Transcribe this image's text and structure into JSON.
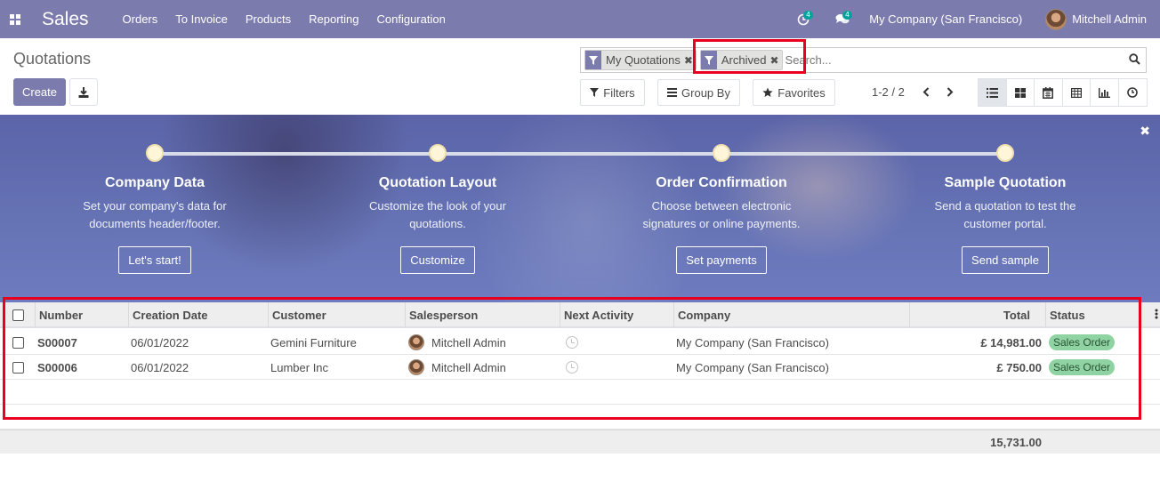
{
  "navbar": {
    "app_name": "Sales",
    "menu": [
      "Orders",
      "To Invoice",
      "Products",
      "Reporting",
      "Configuration"
    ],
    "activity_count": "4",
    "message_count": "4",
    "company": "My Company (San Francisco)",
    "user": "Mitchell Admin",
    "bg_color": "#7c7bad"
  },
  "control": {
    "breadcrumb": "Quotations",
    "create_label": "Create",
    "search": {
      "facets": [
        "My Quotations",
        "Archived"
      ],
      "placeholder": "Search..."
    },
    "filters_label": "Filters",
    "groupby_label": "Group By",
    "favorites_label": "Favorites",
    "pager": "1-2 / 2"
  },
  "banner": {
    "steps": [
      {
        "title": "Company Data",
        "desc1": "Set your company's data for",
        "desc2": "documents header/footer.",
        "button": "Let's start!"
      },
      {
        "title": "Quotation Layout",
        "desc1": "Customize the look of your",
        "desc2": "quotations.",
        "button": "Customize"
      },
      {
        "title": "Order Confirmation",
        "desc1": "Choose between electronic",
        "desc2": "signatures or online payments.",
        "button": "Set payments"
      },
      {
        "title": "Sample Quotation",
        "desc1": "Send a quotation to test the",
        "desc2": "customer portal.",
        "button": "Send sample"
      }
    ]
  },
  "list": {
    "columns": [
      "Number",
      "Creation Date",
      "Customer",
      "Salesperson",
      "Next Activity",
      "Company",
      "Total",
      "Status"
    ],
    "rows": [
      {
        "number": "S00007",
        "date": "06/01/2022",
        "customer": "Gemini Furniture",
        "salesperson": "Mitchell Admin",
        "company": "My Company (San Francisco)",
        "total": "£ 14,981.00",
        "status": "Sales Order"
      },
      {
        "number": "S00006",
        "date": "06/01/2022",
        "customer": "Lumber Inc",
        "salesperson": "Mitchell Admin",
        "company": "My Company (San Francisco)",
        "total": "£ 750.00",
        "status": "Sales Order"
      }
    ],
    "sum_total": "15,731.00"
  }
}
